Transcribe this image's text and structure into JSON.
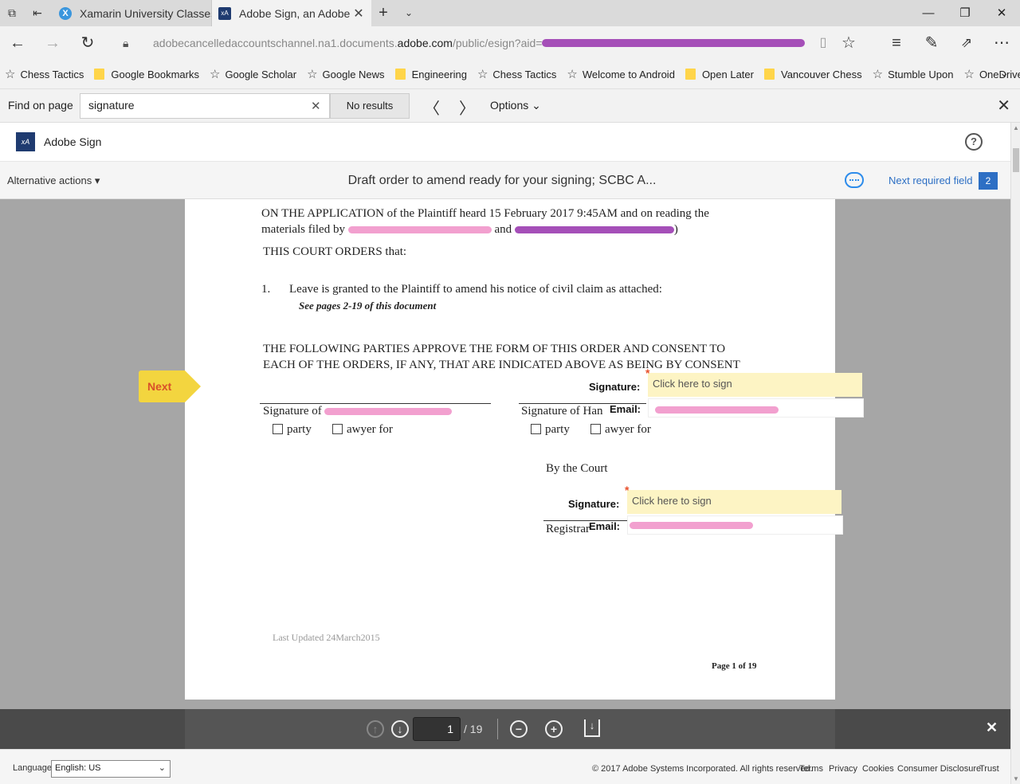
{
  "browser": {
    "tabs": [
      {
        "label": "Xamarin University Classes",
        "favicon": "X"
      },
      {
        "label": "Adobe Sign, an Adobe I",
        "favicon": "Adobe Sign"
      }
    ],
    "address": {
      "prefix": "adobecancelledaccountschannel.na1.documents.",
      "host": "adobe.com",
      "path": "/public/esign?aid="
    },
    "favorites": [
      {
        "label": "Chess Tactics",
        "icon": "star-icon"
      },
      {
        "label": "Google Bookmarks",
        "icon": "folder-icon"
      },
      {
        "label": "Google Scholar",
        "icon": "star-icon"
      },
      {
        "label": "Google News",
        "icon": "star-icon"
      },
      {
        "label": "Engineering",
        "icon": "folder-icon"
      },
      {
        "label": "Chess Tactics",
        "icon": "star-icon"
      },
      {
        "label": "Welcome to Android",
        "icon": "star-icon"
      },
      {
        "label": "Open Later",
        "icon": "folder-icon"
      },
      {
        "label": "Vancouver Chess",
        "icon": "folder-icon"
      },
      {
        "label": "Stumble Upon",
        "icon": "star-icon"
      },
      {
        "label": "OneDrive",
        "icon": "star-icon"
      }
    ],
    "find": {
      "label": "Find on page",
      "value": "signature",
      "results": "No results",
      "options": "Options"
    }
  },
  "app": {
    "name": "Adobe Sign",
    "alt_actions": "Alternative actions",
    "doc_title": "Draft order to amend ready for your signing; SCBC A...",
    "next_required": "Next required field",
    "required_count": "2",
    "next_tag": "Next"
  },
  "document": {
    "para1_line1": "ON THE APPLICATION of the Plaintiff heard 15 February 2017 9:45AM and on reading the",
    "para1_line2_start": "materials filed by ",
    "para1_line2_mid": " and ",
    "para1_line2_end": ")",
    "orders": "THIS COURT ORDERS that:",
    "item_num": "1.",
    "item_text": "Leave is granted to the Plaintiff to amend his notice of civil claim as attached:",
    "see_pages": "See pages 2-19 of this document",
    "parties_line1": "THE FOLLOWING PARTIES APPROVE THE FORM OF THIS ORDER AND CONSENT TO",
    "parties_line2": "EACH OF THE ORDERS, IF ANY, THAT ARE INDICATED ABOVE AS BEING BY CONSENT",
    "signature_label": "Signature:",
    "click_to_sign": "Click here to sign",
    "email_label": "Email:",
    "sig_left": "Signature of ",
    "sig_right": "Signature of Han ",
    "party": "party",
    "lawyer_for": "awyer for",
    "by_court": "By the Court",
    "registrar": "Registrar",
    "last_updated": "Last Updated 24March2015",
    "page_of": "Page 1 of 19"
  },
  "pdf_toolbar": {
    "page": "1",
    "total": "/ 19"
  },
  "footer": {
    "language_label": "Language",
    "language_value": "English: US",
    "copyright": "© 2017 Adobe Systems Incorporated. All rights reserved.",
    "links": [
      "Terms",
      "Privacy",
      "Cookies",
      "Consumer Disclosure",
      "Trust"
    ]
  }
}
